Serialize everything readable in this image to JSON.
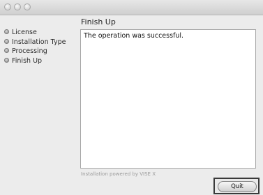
{
  "sidebar": {
    "steps": [
      {
        "label": "License"
      },
      {
        "label": "Installation Type"
      },
      {
        "label": "Processing"
      },
      {
        "label": "Finish Up"
      }
    ]
  },
  "main": {
    "title": "Finish Up",
    "message": "The operation was successful.",
    "footer": "Installation powered by VISE X"
  },
  "buttons": {
    "quit_label": "Quit"
  }
}
